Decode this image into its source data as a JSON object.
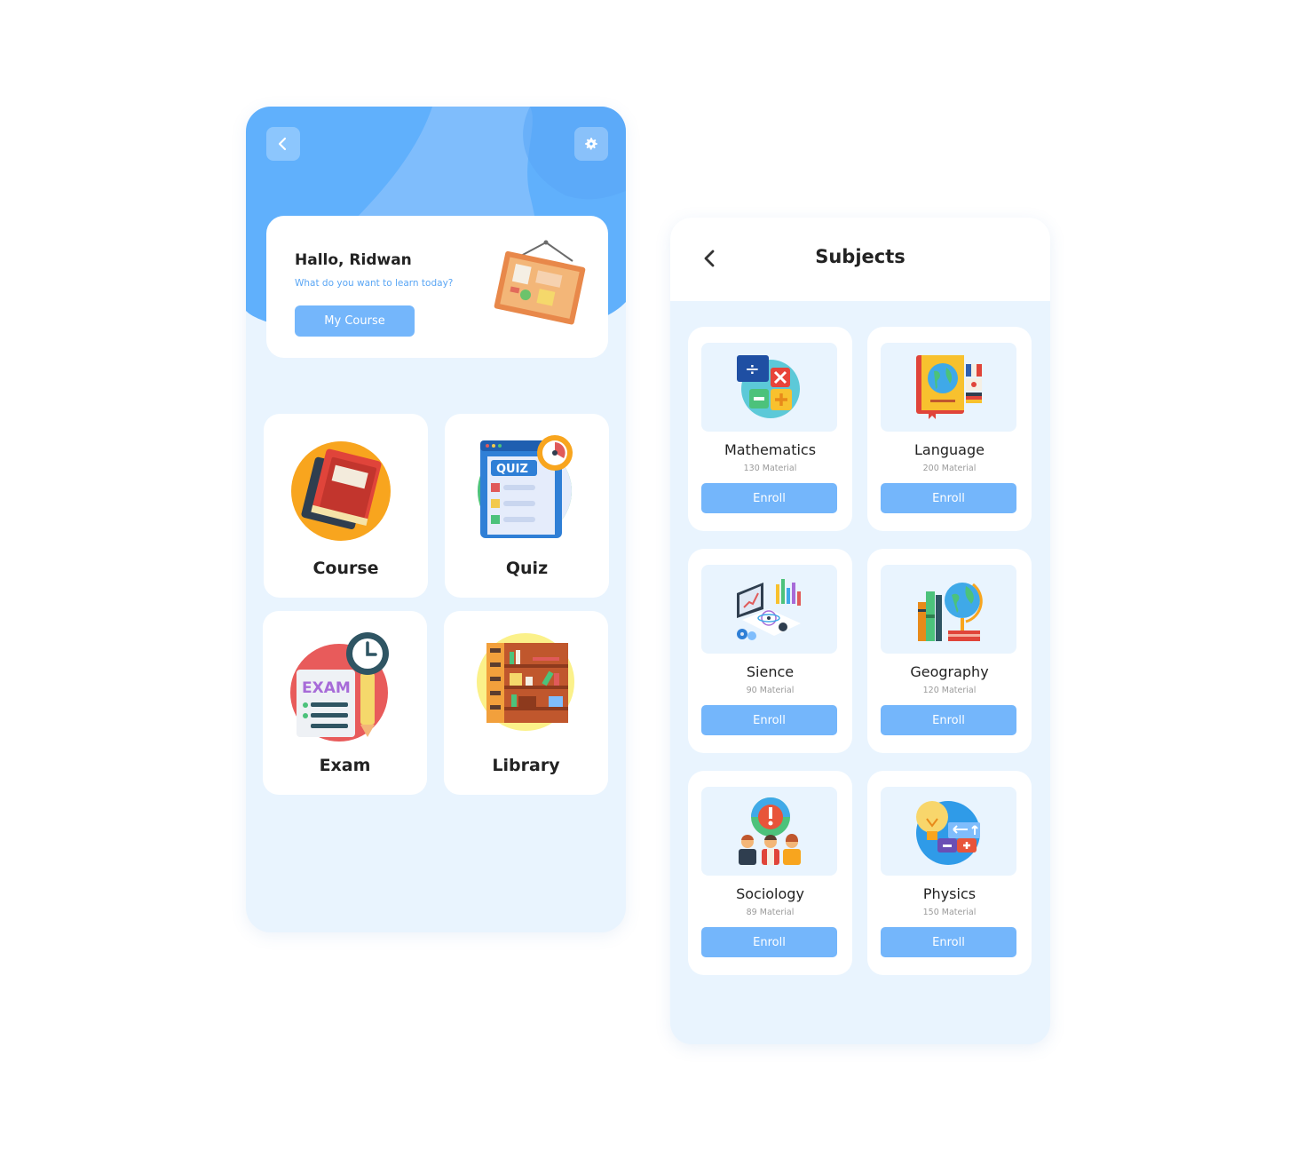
{
  "home": {
    "greeting": "Hallo, Ridwan",
    "subtitle": "What do you want to learn today?",
    "my_course_label": "My Course",
    "menu": [
      {
        "label": "Course",
        "icon": "books-icon"
      },
      {
        "label": "Quiz",
        "icon": "quiz-icon"
      },
      {
        "label": "Exam",
        "icon": "exam-icon"
      },
      {
        "label": "Library",
        "icon": "bookshelf-icon"
      }
    ]
  },
  "subjects": {
    "title": "Subjects",
    "items": [
      {
        "name": "Mathematics",
        "count": "130 Material",
        "enroll": "Enroll",
        "icon": "math-icon"
      },
      {
        "name": "Language",
        "count": "200 Material",
        "enroll": "Enroll",
        "icon": "language-icon"
      },
      {
        "name": "Sience",
        "count": "90 Material",
        "enroll": "Enroll",
        "icon": "science-icon"
      },
      {
        "name": "Geography",
        "count": "120 Material",
        "enroll": "Enroll",
        "icon": "globe-icon"
      },
      {
        "name": "Sociology",
        "count": "89 Material",
        "enroll": "Enroll",
        "icon": "people-icon"
      },
      {
        "name": "Physics",
        "count": "150 Material",
        "enroll": "Enroll",
        "icon": "lightbulb-icon"
      }
    ]
  },
  "colors": {
    "accent": "#74b6fb",
    "header_blue": "#60b0fc",
    "background": "#e9f4fe"
  }
}
